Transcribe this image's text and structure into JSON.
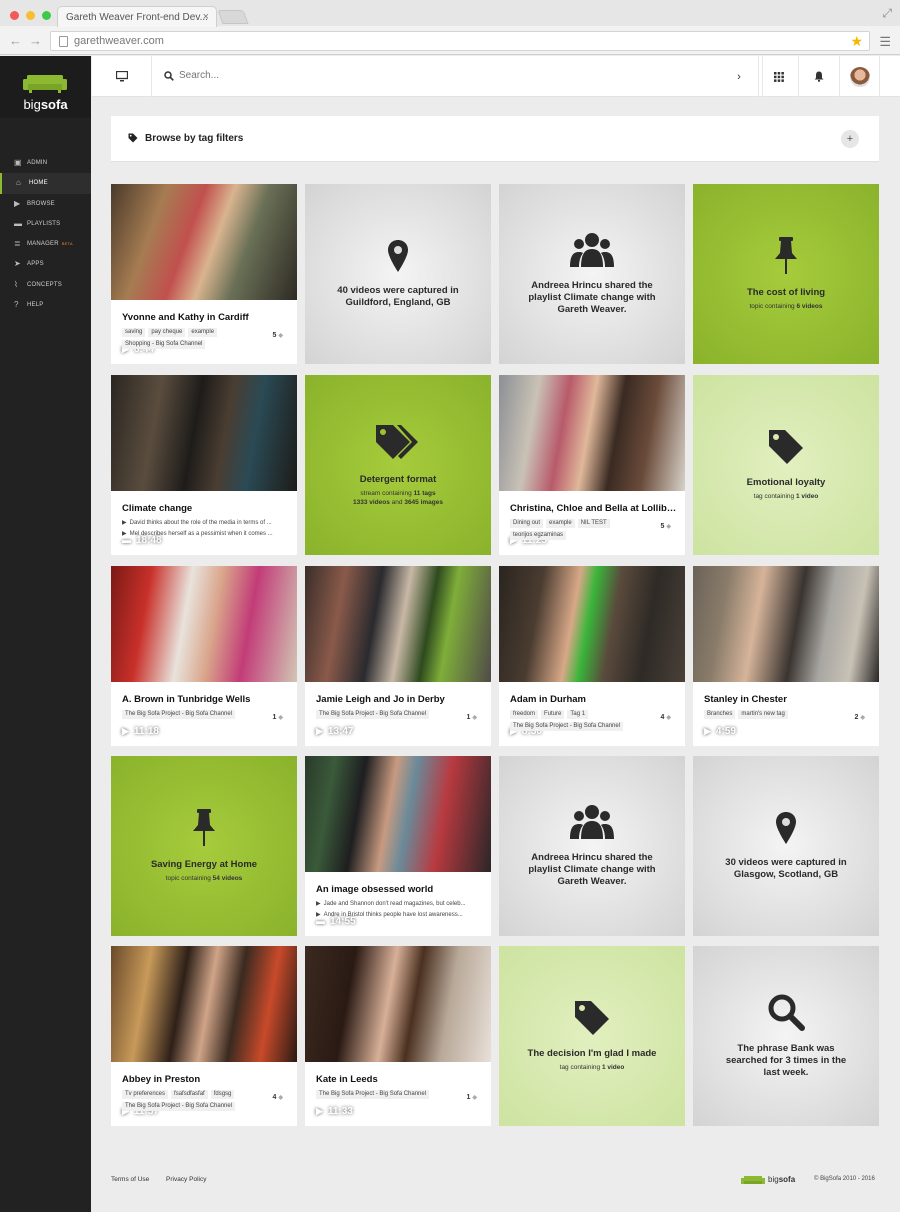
{
  "browser": {
    "tab_title": "Gareth Weaver Front-end Dev...",
    "tab_close": "×",
    "url": "garethweaver.com"
  },
  "app": {
    "logo_big": "big",
    "logo_sofa": "sofa",
    "brand_color": "#8cb832"
  },
  "sidebar": {
    "items": [
      {
        "label": "Admin",
        "icon": "admin-icon",
        "glyph": "▣"
      },
      {
        "label": "Home",
        "icon": "home-icon",
        "glyph": "⌂",
        "active": true
      },
      {
        "label": "Browse",
        "icon": "play-icon",
        "glyph": "▶"
      },
      {
        "label": "Playlists",
        "icon": "folder-icon",
        "glyph": "▬"
      },
      {
        "label": "Manager",
        "icon": "list-icon",
        "glyph": "≣",
        "badge": "BETA"
      },
      {
        "label": "Apps",
        "icon": "rocket-icon",
        "glyph": "➤"
      },
      {
        "label": "Concepts",
        "icon": "chart-icon",
        "glyph": "⌇"
      },
      {
        "label": "Help",
        "icon": "help-icon",
        "glyph": "?"
      }
    ]
  },
  "topbar": {
    "search_placeholder": "Search..."
  },
  "filter": {
    "label": "Browse by tag filters",
    "plus": "+"
  },
  "cards": {
    "c1": {
      "title": "Yvonne and Kathy in Cardiff",
      "duration": "6:44",
      "tags": [
        "saving",
        "pay cheque",
        "example",
        "Shopping - Big Sofa Channel"
      ],
      "count": "5"
    },
    "c2": {
      "text": "40 videos were captured in Guildford, England, GB"
    },
    "c3": {
      "text": "Andreea Hrincu shared the playlist Climate change with Gareth Weaver."
    },
    "c4": {
      "title": "The cost of living",
      "sub_pre": "topic containing ",
      "sub_bold": "6 videos"
    },
    "c5": {
      "title": "Climate change",
      "duration": "18:48",
      "subs": [
        "David thinks about the role of the media in terms of ...",
        "Mel describes herself as a pessimist when it comes ..."
      ]
    },
    "c6": {
      "title": "Detergent format",
      "sub1_pre": "stream containing ",
      "sub1_bold": "11 tags",
      "sub2_bold1": "1333 videos",
      "sub2_mid": " and ",
      "sub2_bold2": "3645 images"
    },
    "c7": {
      "title": "Christina, Chloe and Bella at Lollibo...",
      "duration": "11:25",
      "tags": [
        "Dining out",
        "example",
        "NIL TEST",
        "teorijos egzaminas"
      ],
      "count": "5"
    },
    "c8": {
      "title": "Emotional loyalty",
      "sub_pre": "tag containing ",
      "sub_bold": "1 video"
    },
    "c9": {
      "title": "A. Brown in Tunbridge Wells",
      "duration": "11:18",
      "tags": [
        "The Big Sofa Project - Big Sofa Channel"
      ],
      "count": "1"
    },
    "c10": {
      "title": "Jamie Leigh and Jo in Derby",
      "duration": "13:47",
      "tags": [
        "The Big Sofa Project - Big Sofa Channel"
      ],
      "count": "1"
    },
    "c11": {
      "title": "Adam in Durham",
      "duration": "8:30",
      "tags": [
        "freedom",
        "Future",
        "Tag 1",
        "The Big Sofa Project - Big Sofa Channel"
      ],
      "count": "4"
    },
    "c12": {
      "title": "Stanley in Chester",
      "duration": "4:59",
      "tags": [
        "Branches",
        "martin's new tag"
      ],
      "count": "2"
    },
    "c13": {
      "title": "Saving Energy at Home",
      "sub_pre": "topic containing ",
      "sub_bold": "54 videos"
    },
    "c14": {
      "title": "An image obsessed world",
      "duration": "14:55",
      "subs": [
        "Jade and Shannon don't read magazines, but celeb...",
        "Andre in Bristol thinks people have lost awareness..."
      ]
    },
    "c15": {
      "text": "Andreea Hrincu shared the playlist Climate change with Gareth Weaver."
    },
    "c16": {
      "text": "30 videos were captured in Glasgow, Scotland, GB"
    },
    "c17": {
      "title": "Abbey in Preston",
      "duration": "11:57",
      "tags": [
        "Tv preferences",
        "fsafsdfasfaf",
        "fdsgsg",
        "The Big Sofa Project - Big Sofa Channel"
      ],
      "count": "4"
    },
    "c18": {
      "title": "Kate in Leeds",
      "duration": "11:33",
      "tags": [
        "The Big Sofa Project - Big Sofa Channel"
      ],
      "count": "1"
    },
    "c19": {
      "title": "The decision I'm glad I made",
      "sub_pre": "tag containing ",
      "sub_bold": "1 video"
    },
    "c20": {
      "text": "The phrase Bank was searched for 3 times in the last week."
    }
  },
  "footer": {
    "terms": "Terms of Use",
    "privacy": "Privacy Policy",
    "logo_big": "big",
    "logo_sofa": "sofa",
    "copyright": "© BigSofa 2010 - 2016"
  }
}
